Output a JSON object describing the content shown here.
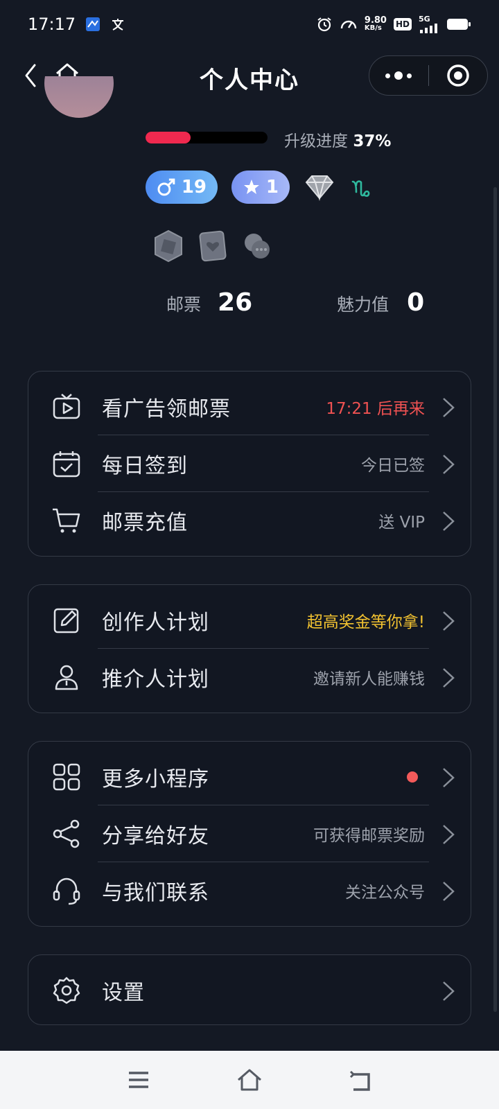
{
  "status_bar": {
    "time": "17:17",
    "speed": "9.80",
    "speed_unit": "KB/s",
    "hd": "HD",
    "network": "5G"
  },
  "nav": {
    "title": "个人中心"
  },
  "level": {
    "progress_percent": 37,
    "progress_label": "升级进度",
    "progress_value": "37%"
  },
  "badges": {
    "gender_value": "19",
    "star_value": "1"
  },
  "stats": {
    "stamps_label": "邮票",
    "stamps_value": "26",
    "charm_label": "魅力值",
    "charm_value": "0"
  },
  "card1": {
    "rows": [
      {
        "title": "看广告领邮票",
        "hint": "17:21 后再来"
      },
      {
        "title": "每日签到",
        "hint": "今日已签"
      },
      {
        "title": "邮票充值",
        "hint": "送 VIP"
      }
    ]
  },
  "card2": {
    "rows": [
      {
        "title": "创作人计划",
        "hint": "超高奖金等你拿!"
      },
      {
        "title": "推介人计划",
        "hint": "邀请新人能赚钱"
      }
    ]
  },
  "card3": {
    "rows": [
      {
        "title": "更多小程序",
        "hint": ""
      },
      {
        "title": "分享给好友",
        "hint": "可获得邮票奖励"
      },
      {
        "title": "与我们联系",
        "hint": "关注公众号"
      }
    ]
  },
  "card4": {
    "rows": [
      {
        "title": "设置"
      }
    ]
  },
  "colors": {
    "background": "#141924",
    "progress": "#f0294f",
    "hint_red": "#f05252",
    "hint_gold": "#f2c230"
  }
}
